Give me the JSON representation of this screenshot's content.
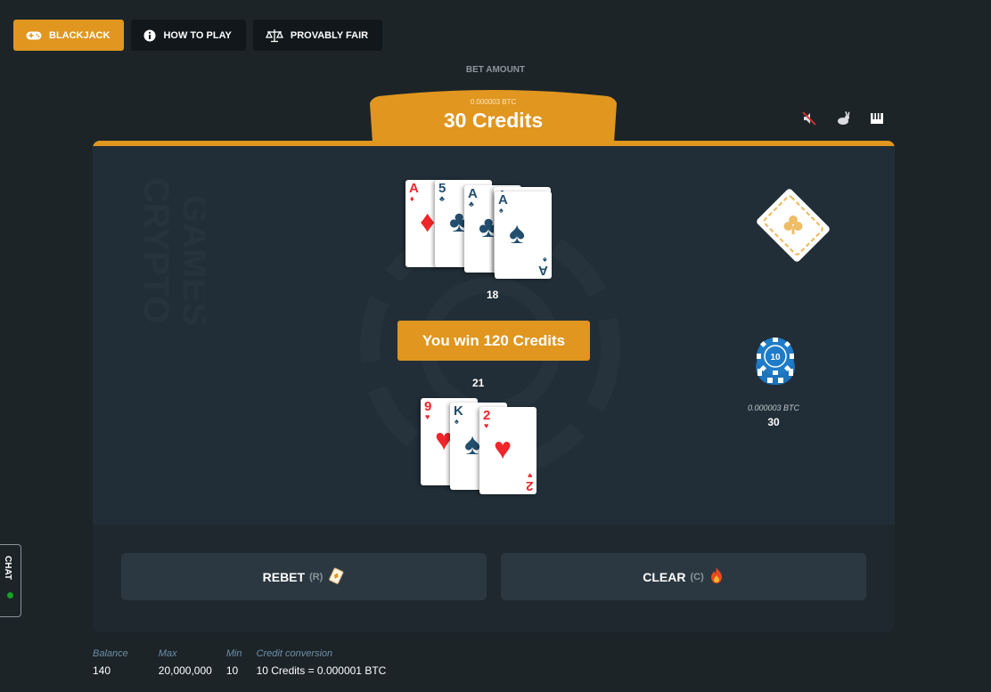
{
  "nav": {
    "tabs": [
      {
        "label": "BLACKJACK",
        "icon": "gamepad-icon",
        "active": true
      },
      {
        "label": "HOW TO PLAY",
        "icon": "info-icon",
        "active": false
      },
      {
        "label": "PROVABLY FAIR",
        "icon": "scales-icon",
        "active": false
      }
    ]
  },
  "bet": {
    "label": "BET AMOUNT",
    "btc": "0.000003 BTC",
    "credits": "30 Credits"
  },
  "toolbar_icons": [
    "sound-off-icon",
    "rabbit-speed-icon",
    "piano-icon"
  ],
  "watermark": {
    "line1": "CRYPTO",
    "line2": "GAMES"
  },
  "dealer": {
    "cards": [
      {
        "rank": "A",
        "suit": "♦",
        "color": "red"
      },
      {
        "rank": "5",
        "suit": "♣",
        "color": "blue"
      },
      {
        "rank": "A",
        "suit": "♣",
        "color": "blue"
      },
      {
        "rank": "A",
        "suit": "♣",
        "color": "blue"
      },
      {
        "rank": "A",
        "suit": "♠",
        "color": "blue"
      }
    ],
    "total": "18"
  },
  "result": {
    "text": "You win 120 Credits"
  },
  "player": {
    "total": "21",
    "cards": [
      {
        "rank": "9",
        "suit": "♥",
        "color": "red"
      },
      {
        "rank": "K",
        "suit": "♠",
        "color": "blue"
      },
      {
        "rank": "2",
        "suit": "♥",
        "color": "red"
      }
    ]
  },
  "chip": {
    "denomination": "10",
    "btc": "0.000003 BTC",
    "amount": "30"
  },
  "actions": {
    "rebet": {
      "label": "REBET",
      "key": "(R)",
      "icon": "card-icon"
    },
    "clear": {
      "label": "CLEAR",
      "key": "(C)",
      "icon": "fire-icon"
    }
  },
  "chat": {
    "label": "CHAT",
    "status_color": "#15a324"
  },
  "footer": {
    "balance_label": "Balance",
    "balance": "140",
    "max_label": "Max",
    "max": "20,000,000",
    "min_label": "Min",
    "min": "10",
    "conversion_label": "Credit conversion",
    "conversion": "10 Credits = 0.000001 BTC"
  },
  "colors": {
    "accent": "#e0961f",
    "background": "#1c2428",
    "felt": "#212e37",
    "card_red": "#f0262b",
    "card_blue": "#234e6d"
  }
}
